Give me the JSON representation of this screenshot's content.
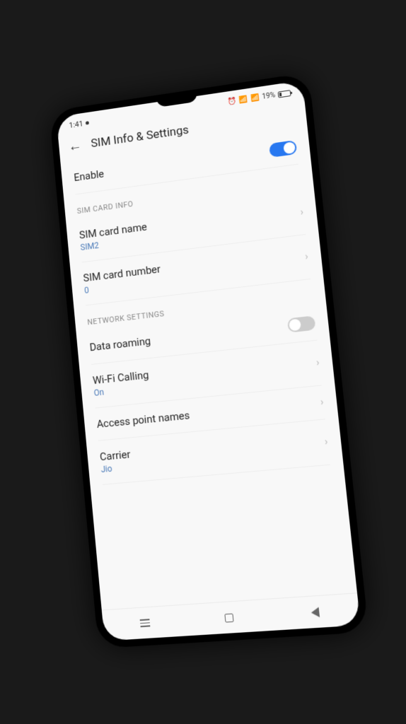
{
  "status": {
    "time": "1:41",
    "battery_text": "19%"
  },
  "header": {
    "title": "SIM Info & Settings"
  },
  "enable": {
    "label": "Enable",
    "on": true
  },
  "sections": {
    "sim_info": {
      "header": "SIM CARD INFO",
      "name": {
        "label": "SIM card name",
        "value": "SIM2"
      },
      "number": {
        "label": "SIM card number",
        "value": "0"
      }
    },
    "network": {
      "header": "NETWORK SETTINGS",
      "roaming": {
        "label": "Data roaming"
      },
      "wifi_calling": {
        "label": "Wi-Fi Calling",
        "value": "On"
      },
      "apn": {
        "label": "Access point names"
      },
      "carrier": {
        "label": "Carrier",
        "value": "Jio"
      }
    }
  }
}
